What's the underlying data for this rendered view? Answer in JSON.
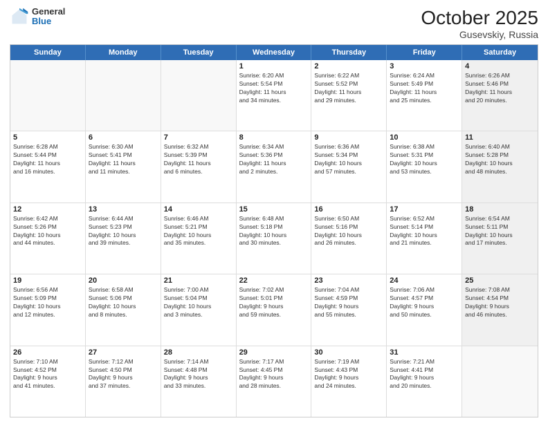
{
  "header": {
    "logo_general": "General",
    "logo_blue": "Blue",
    "title": "October 2025",
    "subtitle": "Gusevskiy, Russia"
  },
  "weekdays": [
    "Sunday",
    "Monday",
    "Tuesday",
    "Wednesday",
    "Thursday",
    "Friday",
    "Saturday"
  ],
  "rows": [
    [
      {
        "day": "",
        "info": "",
        "empty": true
      },
      {
        "day": "",
        "info": "",
        "empty": true
      },
      {
        "day": "",
        "info": "",
        "empty": true
      },
      {
        "day": "1",
        "info": "Sunrise: 6:20 AM\nSunset: 5:54 PM\nDaylight: 11 hours\nand 34 minutes."
      },
      {
        "day": "2",
        "info": "Sunrise: 6:22 AM\nSunset: 5:52 PM\nDaylight: 11 hours\nand 29 minutes."
      },
      {
        "day": "3",
        "info": "Sunrise: 6:24 AM\nSunset: 5:49 PM\nDaylight: 11 hours\nand 25 minutes."
      },
      {
        "day": "4",
        "info": "Sunrise: 6:26 AM\nSunset: 5:46 PM\nDaylight: 11 hours\nand 20 minutes.",
        "shaded": true
      }
    ],
    [
      {
        "day": "5",
        "info": "Sunrise: 6:28 AM\nSunset: 5:44 PM\nDaylight: 11 hours\nand 16 minutes."
      },
      {
        "day": "6",
        "info": "Sunrise: 6:30 AM\nSunset: 5:41 PM\nDaylight: 11 hours\nand 11 minutes."
      },
      {
        "day": "7",
        "info": "Sunrise: 6:32 AM\nSunset: 5:39 PM\nDaylight: 11 hours\nand 6 minutes."
      },
      {
        "day": "8",
        "info": "Sunrise: 6:34 AM\nSunset: 5:36 PM\nDaylight: 11 hours\nand 2 minutes."
      },
      {
        "day": "9",
        "info": "Sunrise: 6:36 AM\nSunset: 5:34 PM\nDaylight: 10 hours\nand 57 minutes."
      },
      {
        "day": "10",
        "info": "Sunrise: 6:38 AM\nSunset: 5:31 PM\nDaylight: 10 hours\nand 53 minutes."
      },
      {
        "day": "11",
        "info": "Sunrise: 6:40 AM\nSunset: 5:28 PM\nDaylight: 10 hours\nand 48 minutes.",
        "shaded": true
      }
    ],
    [
      {
        "day": "12",
        "info": "Sunrise: 6:42 AM\nSunset: 5:26 PM\nDaylight: 10 hours\nand 44 minutes."
      },
      {
        "day": "13",
        "info": "Sunrise: 6:44 AM\nSunset: 5:23 PM\nDaylight: 10 hours\nand 39 minutes."
      },
      {
        "day": "14",
        "info": "Sunrise: 6:46 AM\nSunset: 5:21 PM\nDaylight: 10 hours\nand 35 minutes."
      },
      {
        "day": "15",
        "info": "Sunrise: 6:48 AM\nSunset: 5:18 PM\nDaylight: 10 hours\nand 30 minutes."
      },
      {
        "day": "16",
        "info": "Sunrise: 6:50 AM\nSunset: 5:16 PM\nDaylight: 10 hours\nand 26 minutes."
      },
      {
        "day": "17",
        "info": "Sunrise: 6:52 AM\nSunset: 5:14 PM\nDaylight: 10 hours\nand 21 minutes."
      },
      {
        "day": "18",
        "info": "Sunrise: 6:54 AM\nSunset: 5:11 PM\nDaylight: 10 hours\nand 17 minutes.",
        "shaded": true
      }
    ],
    [
      {
        "day": "19",
        "info": "Sunrise: 6:56 AM\nSunset: 5:09 PM\nDaylight: 10 hours\nand 12 minutes."
      },
      {
        "day": "20",
        "info": "Sunrise: 6:58 AM\nSunset: 5:06 PM\nDaylight: 10 hours\nand 8 minutes."
      },
      {
        "day": "21",
        "info": "Sunrise: 7:00 AM\nSunset: 5:04 PM\nDaylight: 10 hours\nand 3 minutes."
      },
      {
        "day": "22",
        "info": "Sunrise: 7:02 AM\nSunset: 5:01 PM\nDaylight: 9 hours\nand 59 minutes."
      },
      {
        "day": "23",
        "info": "Sunrise: 7:04 AM\nSunset: 4:59 PM\nDaylight: 9 hours\nand 55 minutes."
      },
      {
        "day": "24",
        "info": "Sunrise: 7:06 AM\nSunset: 4:57 PM\nDaylight: 9 hours\nand 50 minutes."
      },
      {
        "day": "25",
        "info": "Sunrise: 7:08 AM\nSunset: 4:54 PM\nDaylight: 9 hours\nand 46 minutes.",
        "shaded": true
      }
    ],
    [
      {
        "day": "26",
        "info": "Sunrise: 7:10 AM\nSunset: 4:52 PM\nDaylight: 9 hours\nand 41 minutes."
      },
      {
        "day": "27",
        "info": "Sunrise: 7:12 AM\nSunset: 4:50 PM\nDaylight: 9 hours\nand 37 minutes."
      },
      {
        "day": "28",
        "info": "Sunrise: 7:14 AM\nSunset: 4:48 PM\nDaylight: 9 hours\nand 33 minutes."
      },
      {
        "day": "29",
        "info": "Sunrise: 7:17 AM\nSunset: 4:45 PM\nDaylight: 9 hours\nand 28 minutes."
      },
      {
        "day": "30",
        "info": "Sunrise: 7:19 AM\nSunset: 4:43 PM\nDaylight: 9 hours\nand 24 minutes."
      },
      {
        "day": "31",
        "info": "Sunrise: 7:21 AM\nSunset: 4:41 PM\nDaylight: 9 hours\nand 20 minutes."
      },
      {
        "day": "",
        "info": "",
        "empty": true,
        "shaded": true
      }
    ]
  ]
}
